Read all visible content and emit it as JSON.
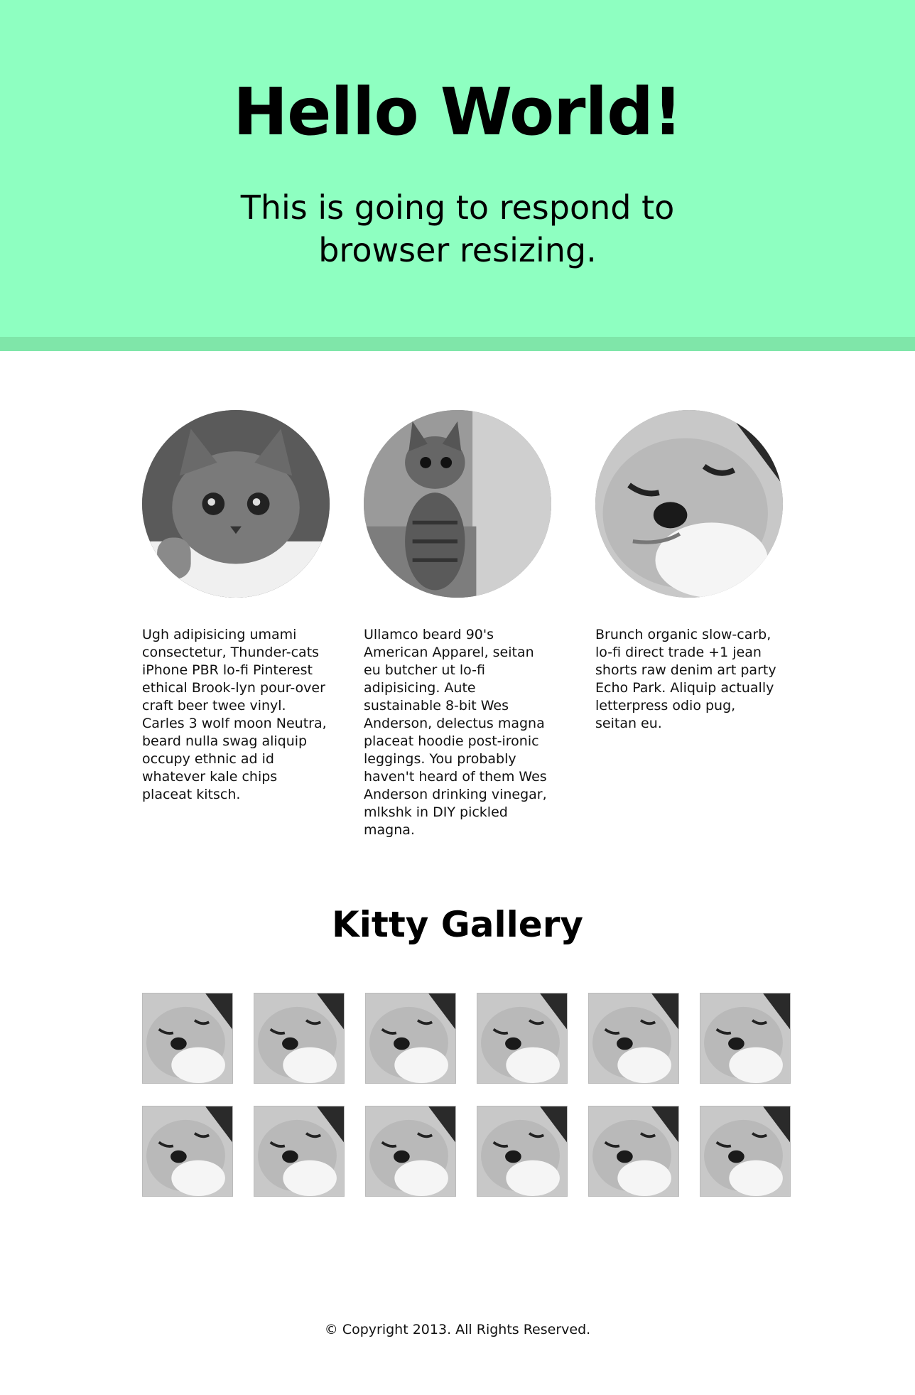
{
  "hero": {
    "title": "Hello World!",
    "subtitle": "This is going to respond to browser resizing."
  },
  "features": [
    {
      "image_icon": "kitten-fluffy-photo",
      "text": "Ugh adipisicing umami consectetur, Thunder-cats iPhone PBR lo-fi Pinterest ethical Brook-lyn pour-over craft beer twee vinyl. Carles 3 wolf moon Neutra, beard nulla swag aliquip occupy ethnic ad id whatever kale chips placeat kitsch."
    },
    {
      "image_icon": "kitten-tabby-photo",
      "text": "Ullamco beard 90's American Apparel, seitan eu butcher ut lo-fi adipisicing. Aute sustainable 8-bit Wes Anderson, delectus magna placeat hoodie post-ironic leggings. You probably haven't heard of them Wes Anderson drinking vinegar, mlkshk in DIY pickled magna."
    },
    {
      "image_icon": "kitten-sleeping-photo",
      "text": "Brunch organic slow-carb, lo-fi direct trade +1 jean shorts raw denim art party Echo Park. Aliquip actually letterpress odio pug, seitan eu."
    }
  ],
  "gallery": {
    "title": "Kitty Gallery",
    "thumb_icon": "kitten-sleeping-photo",
    "count": 12
  },
  "footer": {
    "copyright": "© Copyright 2013. All Rights Reserved."
  },
  "colors": {
    "hero_bg": "#8effc1",
    "hero_border": "#7fe6a9"
  }
}
